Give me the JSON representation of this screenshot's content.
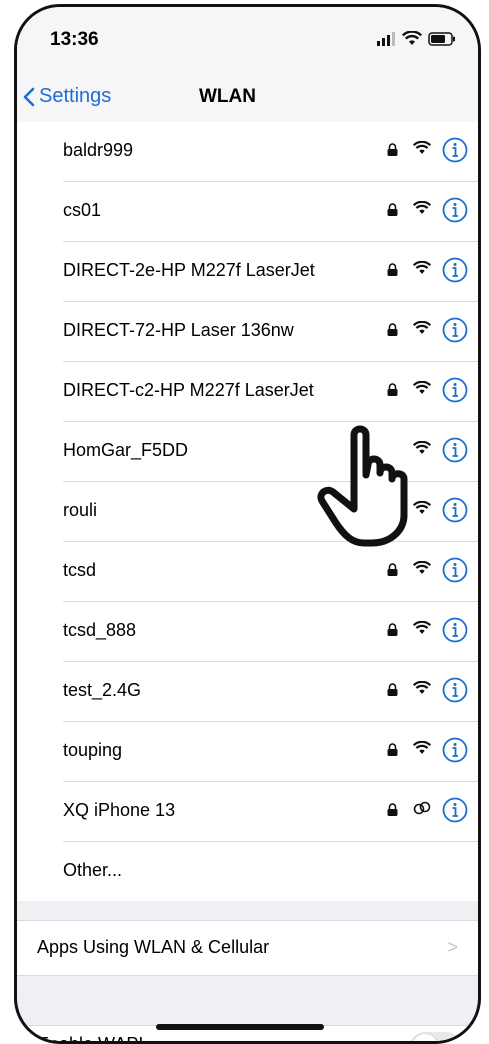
{
  "status_bar": {
    "time": "13:36"
  },
  "nav": {
    "back_label": "Settings",
    "title": "WLAN"
  },
  "networks": [
    {
      "name": "baldr999",
      "locked": true
    },
    {
      "name": "cs01",
      "locked": true
    },
    {
      "name": "DIRECT-2e-HP M227f LaserJet",
      "locked": true
    },
    {
      "name": "DIRECT-72-HP Laser 136nw",
      "locked": true
    },
    {
      "name": "DIRECT-c2-HP M227f LaserJet",
      "locked": true
    },
    {
      "name": "HomGar_F5DD",
      "locked": false
    },
    {
      "name": "rouli",
      "locked": true
    },
    {
      "name": "tcsd",
      "locked": true
    },
    {
      "name": "tcsd_888",
      "locked": true
    },
    {
      "name": "test_2.4G",
      "locked": true
    },
    {
      "name": "touping",
      "locked": true
    },
    {
      "name": "XQ iPhone 13",
      "locked": true,
      "icon": "link-icon"
    }
  ],
  "other_label": "Other...",
  "apps_row": {
    "label": "Apps Using WLAN & Cellular",
    "chevron": ">"
  },
  "wapi_row": {
    "label": "Enable WAPI",
    "enabled": false
  },
  "colors": {
    "accent": "#1a6fd1",
    "background": "#efeff4"
  }
}
